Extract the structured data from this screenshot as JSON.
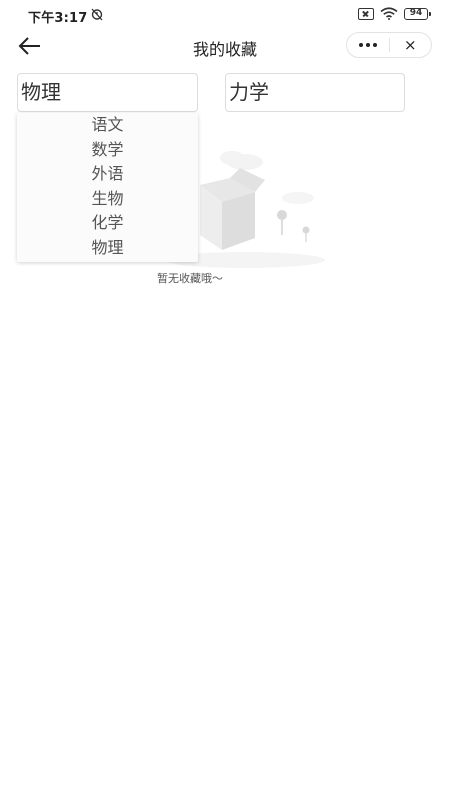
{
  "status_bar": {
    "time": "下午3:17",
    "battery": "94"
  },
  "navbar": {
    "title": "我的收藏",
    "close_label": "×"
  },
  "filters": {
    "primary": {
      "value": "物理"
    },
    "secondary": {
      "value": "力学"
    }
  },
  "dropdown": {
    "options": [
      "语文",
      "数学",
      "外语",
      "生物",
      "化学",
      "物理"
    ]
  },
  "empty_state": {
    "text": "暂无收藏哦～"
  }
}
